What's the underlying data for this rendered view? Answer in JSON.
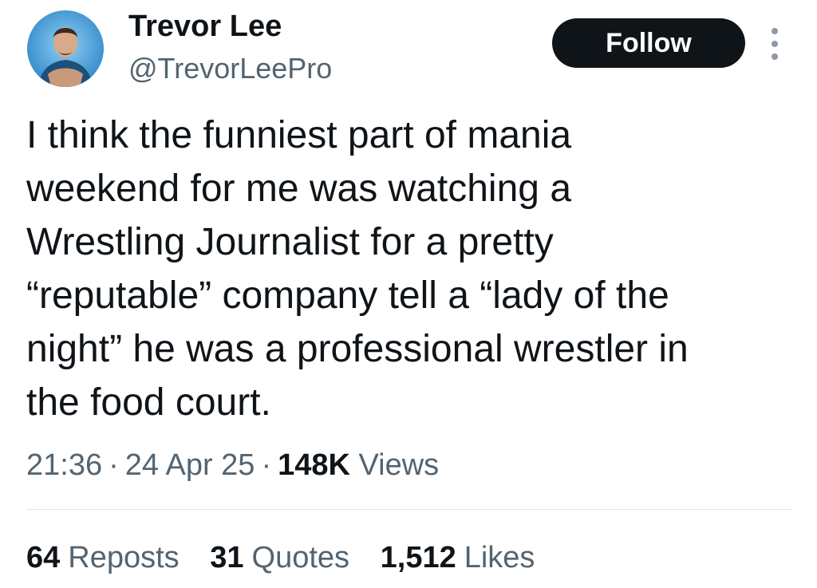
{
  "author": {
    "display_name": "Trevor Lee",
    "handle": "@TrevorLeePro"
  },
  "actions": {
    "follow_label": "Follow",
    "more_icon": "more-vertical-icon"
  },
  "tweet": {
    "text": "I think the funniest part of mania\nweekend for me was watching a\nWrestling Journalist for a pretty\n“reputable” company tell a “lady of the\nnight” he was a professional wrestler in\nthe food court."
  },
  "meta": {
    "time": "21:36",
    "separator": "·",
    "date": "24 Apr 25",
    "views_count": "148K",
    "views_label": "Views"
  },
  "stats": {
    "reposts_count": "64",
    "reposts_label": "Reposts",
    "quotes_count": "31",
    "quotes_label": "Quotes",
    "likes_count": "1,512",
    "likes_label": "Likes"
  },
  "colors": {
    "text_primary": "#0f1419",
    "text_secondary": "#536471",
    "button_bg": "#0f1419",
    "avatar_bg": "#3a8fd0"
  }
}
